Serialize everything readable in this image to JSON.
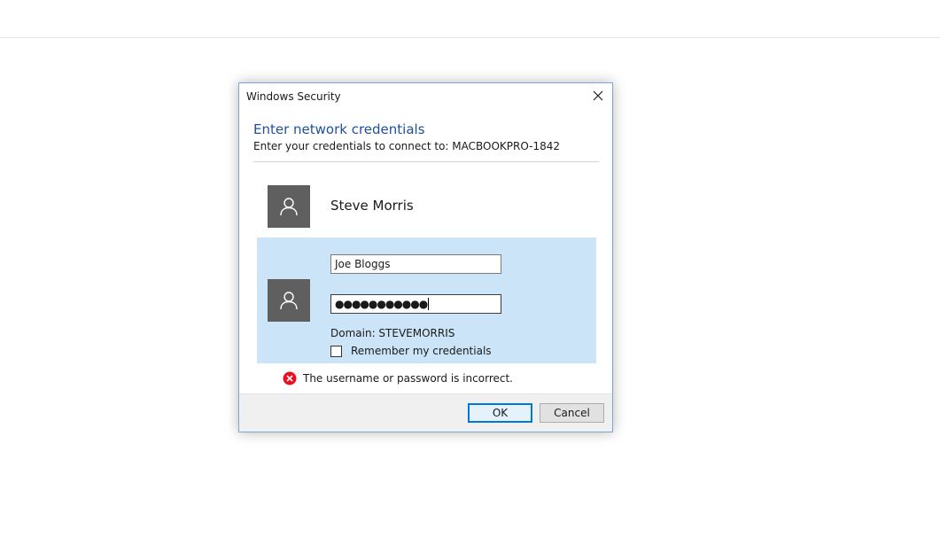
{
  "dialog": {
    "title": "Windows Security",
    "heading": "Enter network credentials",
    "subheading": "Enter your credentials to connect to: MACBOOKPRO-1842",
    "user_tiles": [
      {
        "name": "Steve Morris",
        "icon": "user-icon"
      },
      {
        "icon": "user-icon",
        "username": "Joe Bloggs",
        "password_masked": "●●●●●●●●●●●",
        "domain": "Domain: STEVEMORRIS",
        "remember_label": "Remember my credentials",
        "remember_checked": false
      }
    ],
    "error": {
      "icon": "error-icon",
      "text": "The username or password is incorrect."
    },
    "buttons": {
      "ok": "OK",
      "cancel": "Cancel"
    }
  },
  "colors": {
    "accent": "#0078d7",
    "heading": "#1f4f9f",
    "selected_tile": "#cce4f7",
    "avatar_bg": "#5f5f5f",
    "error": "#e81123"
  }
}
